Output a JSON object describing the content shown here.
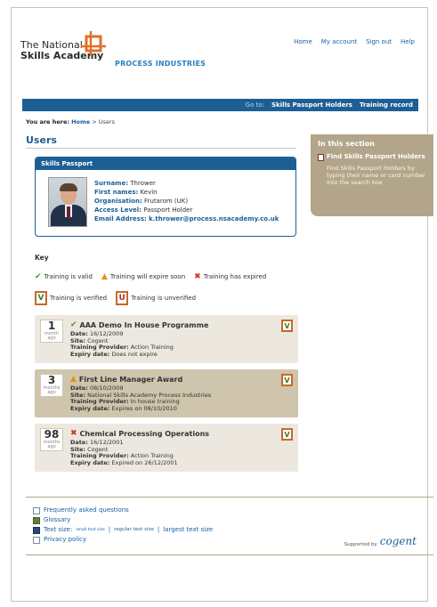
{
  "header": {
    "logo_line1": "The National",
    "logo_line2": "Skills Academy",
    "logo_sub": "PROCESS INDUSTRIES",
    "nav": [
      "Home",
      "My account",
      "Sign out",
      "Help"
    ]
  },
  "bluebar": {
    "goto": "Go to:",
    "links": [
      "Skills Passport Holders",
      "Training record"
    ]
  },
  "breadcrumb": {
    "label": "You are here:",
    "home": "Home",
    "sep": " > ",
    "current": "Users"
  },
  "page_title": "Users",
  "passport": {
    "title": "Skills Passport",
    "fields": [
      {
        "label": "Surname:",
        "value": "Thrower"
      },
      {
        "label": "First names:",
        "value": "Kevin"
      },
      {
        "label": "Organisation:",
        "value": "Frutarom (UK)"
      },
      {
        "label": "Access Level:",
        "value": "Passport Holder"
      },
      {
        "label": "Email Address:",
        "value": "k.thrower@process.nsacademy.co.uk"
      }
    ]
  },
  "sidebar": {
    "title": "In this section",
    "link": "Find Skills Passport Holders",
    "desc": "Find Skills Passport Holders by typing their name or card number into the search box"
  },
  "key": {
    "title": "Key",
    "valid": "Training is valid",
    "expire_soon": "Training will expire soon",
    "expired": "Training has expired",
    "verified": "Training is verified",
    "unverified": "Training is unverified",
    "v_letter": "V",
    "u_letter": "U"
  },
  "records": [
    {
      "num": "1",
      "unit": "month ago",
      "status": "valid",
      "title": "AAA Demo In House Programme",
      "date_label": "Date:",
      "date": "16/12/2009",
      "site_label": "Site:",
      "site": "Cogent",
      "provider_label": "Training Provider:",
      "provider": "Action Training",
      "expiry_label": "Expiry date:",
      "expiry": "Does not expire",
      "badge": "V"
    },
    {
      "num": "3",
      "unit": "months ago",
      "status": "warn",
      "title": "First Line Manager Award",
      "date_label": "Date:",
      "date": "08/10/2009",
      "site_label": "Site:",
      "site": "National Skills Academy Process Industries",
      "provider_label": "Training Provider:",
      "provider": "In house training",
      "expiry_label": "Expiry date:",
      "expiry": "Expires on 08/10/2010",
      "badge": "V"
    },
    {
      "num": "98",
      "unit": "months ago",
      "status": "expired",
      "title": "Chemical Processing Operations",
      "date_label": "Date:",
      "date": "16/12/2001",
      "site_label": "Site:",
      "site": "Cogent",
      "provider_label": "Training Provider:",
      "provider": "Action Training",
      "expiry_label": "Expiry date:",
      "expiry": "Expired on 26/12/2001",
      "badge": "V"
    }
  ],
  "footer": {
    "faq": "Frequently asked questions",
    "glossary": "Glossary",
    "text_size_label": "Text size:",
    "small": "small text size",
    "regular": "regular text size",
    "large": "largest text size",
    "sep": " | ",
    "privacy": "Privacy policy",
    "supported": "Supported by",
    "cogent": "cogent"
  }
}
